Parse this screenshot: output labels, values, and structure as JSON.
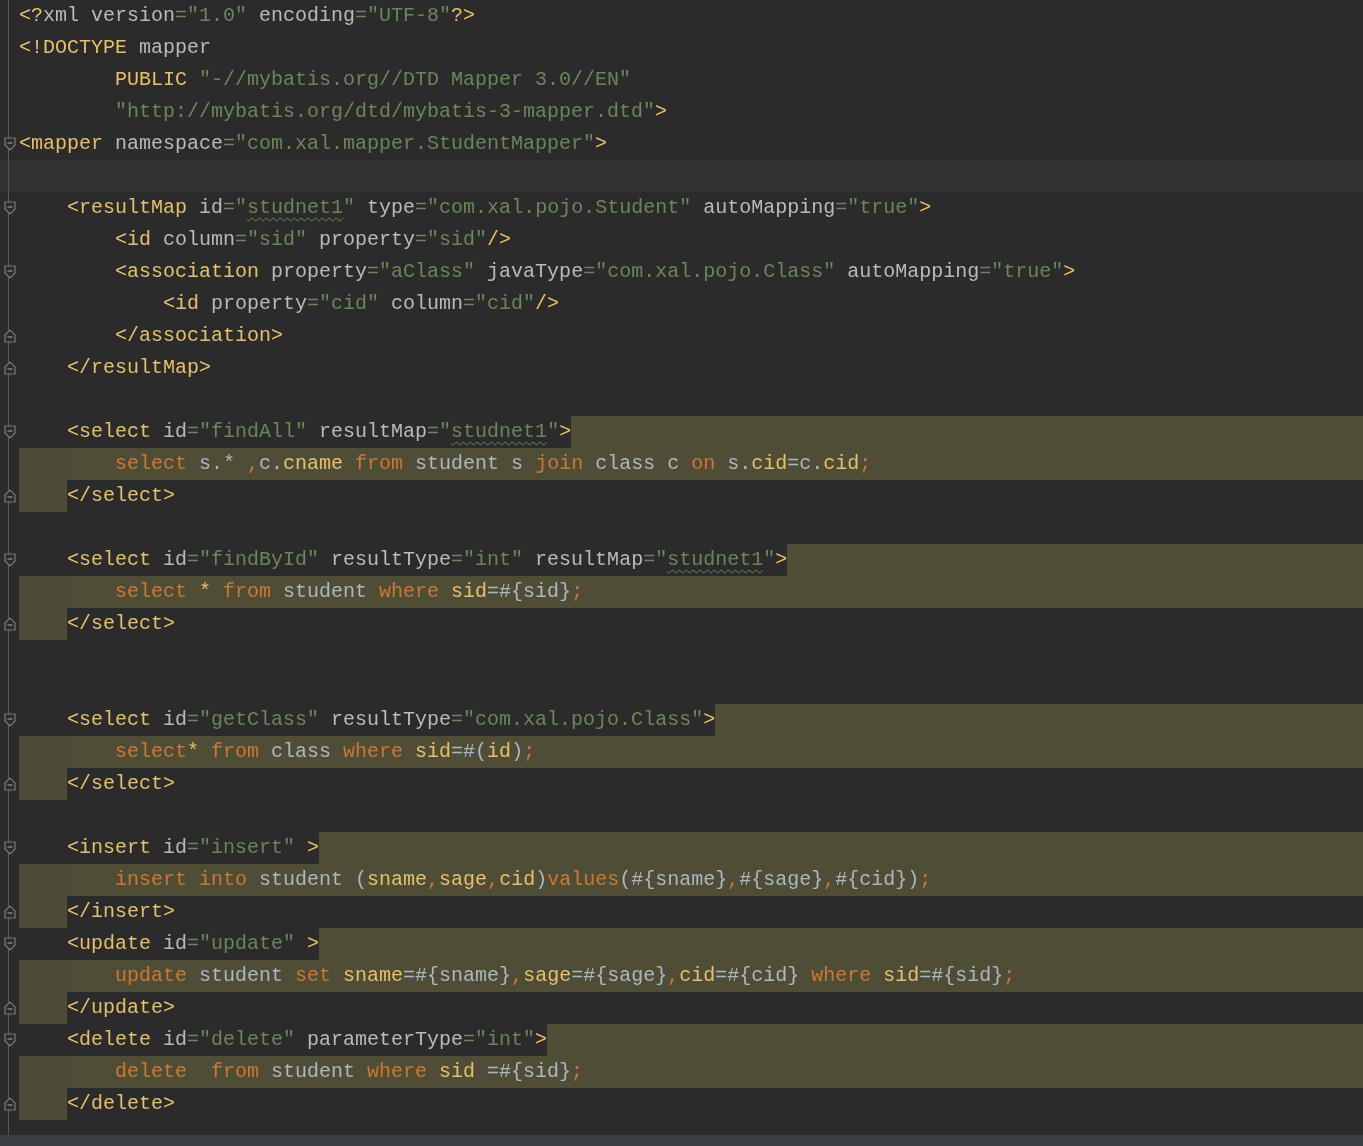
{
  "editor": {
    "lines": [
      {
        "kind": "code",
        "tokens": [
          {
            "text": "<?",
            "kind": "tag"
          },
          {
            "text": "xml version",
            "kind": "attr"
          },
          {
            "text": "=\"1.0\"",
            "kind": "str"
          },
          {
            "text": " encoding",
            "kind": "attr"
          },
          {
            "text": "=\"UTF-8\"",
            "kind": "str"
          },
          {
            "text": "?>",
            "kind": "tag"
          }
        ]
      },
      {
        "kind": "code",
        "tokens": [
          {
            "text": "<!DOCTYPE",
            "kind": "tag"
          },
          {
            "text": " mapper",
            "kind": "attr"
          }
        ]
      },
      {
        "kind": "code",
        "tokens": [
          {
            "text": "        PUBLIC",
            "kind": "tag"
          },
          {
            "text": " \"-//mybatis.org//DTD Mapper 3.0//EN\"",
            "kind": "str"
          }
        ]
      },
      {
        "kind": "code",
        "tokens": [
          {
            "text": "        \"http://mybatis.org/dtd/mybatis-3-mapper.dtd\"",
            "kind": "str"
          },
          {
            "text": ">",
            "kind": "tag"
          }
        ]
      },
      {
        "kind": "code",
        "fold_start": true,
        "tokens": [
          {
            "text": "<mapper",
            "kind": "tag"
          },
          {
            "text": " namespace",
            "kind": "attr"
          },
          {
            "text": "=\"com.xal.mapper.StudentMapper\"",
            "kind": "str"
          },
          {
            "text": ">",
            "kind": "tag"
          }
        ]
      },
      {
        "kind": "blank",
        "current": true
      },
      {
        "kind": "code",
        "fold_start": true,
        "tokens": [
          {
            "text": "    <resultMap",
            "kind": "tag"
          },
          {
            "text": " id",
            "kind": "attr"
          },
          {
            "text": "=\"",
            "kind": "str"
          },
          {
            "text": "studnet1",
            "kind": "typo"
          },
          {
            "text": "\"",
            "kind": "str"
          },
          {
            "text": " type",
            "kind": "attr"
          },
          {
            "text": "=\"com.xal.pojo.Student\"",
            "kind": "str"
          },
          {
            "text": " autoMapping",
            "kind": "attr"
          },
          {
            "text": "=\"true\"",
            "kind": "str"
          },
          {
            "text": ">",
            "kind": "tag"
          }
        ]
      },
      {
        "kind": "code",
        "tokens": [
          {
            "text": "        <id",
            "kind": "tag"
          },
          {
            "text": " column",
            "kind": "attr"
          },
          {
            "text": "=\"sid\"",
            "kind": "str"
          },
          {
            "text": " property",
            "kind": "attr"
          },
          {
            "text": "=\"sid\"",
            "kind": "str"
          },
          {
            "text": "/>",
            "kind": "tag"
          }
        ]
      },
      {
        "kind": "code",
        "fold_start": true,
        "tokens": [
          {
            "text": "        <association",
            "kind": "tag"
          },
          {
            "text": " property",
            "kind": "attr"
          },
          {
            "text": "=\"aClass\"",
            "kind": "str"
          },
          {
            "text": " javaType",
            "kind": "attr"
          },
          {
            "text": "=\"com.xal.pojo.Class\"",
            "kind": "str"
          },
          {
            "text": " autoMapping",
            "kind": "attr"
          },
          {
            "text": "=\"true\"",
            "kind": "str"
          },
          {
            "text": ">",
            "kind": "tag"
          }
        ]
      },
      {
        "kind": "code",
        "tokens": [
          {
            "text": "            <id",
            "kind": "tag"
          },
          {
            "text": " property",
            "kind": "attr"
          },
          {
            "text": "=\"cid\"",
            "kind": "str"
          },
          {
            "text": " column",
            "kind": "attr"
          },
          {
            "text": "=\"cid\"",
            "kind": "str"
          },
          {
            "text": "/>",
            "kind": "tag"
          }
        ]
      },
      {
        "kind": "code",
        "fold_end": true,
        "tokens": [
          {
            "text": "        </association>",
            "kind": "tag"
          }
        ]
      },
      {
        "kind": "code",
        "fold_end": true,
        "tokens": [
          {
            "text": "    </resultMap>",
            "kind": "tag"
          }
        ]
      },
      {
        "kind": "blank"
      },
      {
        "kind": "code",
        "fold_start": true,
        "injection_start": true,
        "tokens": [
          {
            "text": "    <select",
            "kind": "tag"
          },
          {
            "text": " id",
            "kind": "attr"
          },
          {
            "text": "=\"findAll\"",
            "kind": "str"
          },
          {
            "text": " resultMap",
            "kind": "attr"
          },
          {
            "text": "=\"",
            "kind": "str"
          },
          {
            "text": "studnet1",
            "kind": "typo"
          },
          {
            "text": "\"",
            "kind": "str"
          },
          {
            "text": ">",
            "kind": "tag"
          }
        ]
      },
      {
        "kind": "code",
        "injection_body": true,
        "tokens": [
          {
            "text": "        select",
            "kind": "kw"
          },
          {
            "text": " s.* ",
            "kind": "plain"
          },
          {
            "text": ",",
            "kind": "punct"
          },
          {
            "text": "c.",
            "kind": "plain"
          },
          {
            "text": "cname",
            "kind": "col"
          },
          {
            "text": " from",
            "kind": "kw"
          },
          {
            "text": " student s ",
            "kind": "plain"
          },
          {
            "text": "join",
            "kind": "kw"
          },
          {
            "text": " class c ",
            "kind": "plain"
          },
          {
            "text": "on",
            "kind": "kw"
          },
          {
            "text": " s.",
            "kind": "plain"
          },
          {
            "text": "cid",
            "kind": "col"
          },
          {
            "text": "=c.",
            "kind": "plain"
          },
          {
            "text": "cid",
            "kind": "col"
          },
          {
            "text": ";",
            "kind": "punct"
          }
        ]
      },
      {
        "kind": "code",
        "fold_end": true,
        "injection_end": true,
        "tokens": [
          {
            "text": "    </select>",
            "kind": "tag"
          }
        ]
      },
      {
        "kind": "blank"
      },
      {
        "kind": "code",
        "fold_start": true,
        "injection_start": true,
        "tokens": [
          {
            "text": "    <select",
            "kind": "tag"
          },
          {
            "text": " id",
            "kind": "attr"
          },
          {
            "text": "=\"findById\"",
            "kind": "str"
          },
          {
            "text": " resultType",
            "kind": "attr"
          },
          {
            "text": "=\"int\"",
            "kind": "str"
          },
          {
            "text": " resultMap",
            "kind": "attr"
          },
          {
            "text": "=\"",
            "kind": "str"
          },
          {
            "text": "studnet1",
            "kind": "typo"
          },
          {
            "text": "\"",
            "kind": "str"
          },
          {
            "text": ">",
            "kind": "tag"
          }
        ]
      },
      {
        "kind": "code",
        "injection_body": true,
        "tokens": [
          {
            "text": "        select",
            "kind": "kw"
          },
          {
            "text": " * ",
            "kind": "col"
          },
          {
            "text": "from",
            "kind": "kw"
          },
          {
            "text": " student ",
            "kind": "plain"
          },
          {
            "text": "where",
            "kind": "kw"
          },
          {
            "text": " sid",
            "kind": "col"
          },
          {
            "text": "=#{sid}",
            "kind": "plain"
          },
          {
            "text": ";",
            "kind": "punct"
          }
        ]
      },
      {
        "kind": "code",
        "fold_end": true,
        "injection_end": true,
        "tokens": [
          {
            "text": "    </select>",
            "kind": "tag"
          }
        ]
      },
      {
        "kind": "blank"
      },
      {
        "kind": "blank"
      },
      {
        "kind": "code",
        "fold_start": true,
        "injection_start": true,
        "tokens": [
          {
            "text": "    <select",
            "kind": "tag"
          },
          {
            "text": " id",
            "kind": "attr"
          },
          {
            "text": "=\"getClass\"",
            "kind": "str"
          },
          {
            "text": " resultType",
            "kind": "attr"
          },
          {
            "text": "=\"com.xal.pojo.Class\"",
            "kind": "str"
          },
          {
            "text": ">",
            "kind": "tag"
          }
        ]
      },
      {
        "kind": "code",
        "injection_body": true,
        "tokens": [
          {
            "text": "        select",
            "kind": "kw"
          },
          {
            "text": "* ",
            "kind": "col"
          },
          {
            "text": "from",
            "kind": "kw"
          },
          {
            "text": " class ",
            "kind": "plain"
          },
          {
            "text": "where",
            "kind": "kw"
          },
          {
            "text": " sid",
            "kind": "col"
          },
          {
            "text": "=#(",
            "kind": "plain"
          },
          {
            "text": "id",
            "kind": "col"
          },
          {
            "text": ")",
            "kind": "plain"
          },
          {
            "text": ";",
            "kind": "punct"
          }
        ]
      },
      {
        "kind": "code",
        "fold_end": true,
        "injection_end": true,
        "tokens": [
          {
            "text": "    </select>",
            "kind": "tag"
          }
        ]
      },
      {
        "kind": "blank"
      },
      {
        "kind": "code",
        "fold_start": true,
        "injection_start": true,
        "tokens": [
          {
            "text": "    <insert",
            "kind": "tag"
          },
          {
            "text": " id",
            "kind": "attr"
          },
          {
            "text": "=\"insert\"",
            "kind": "str"
          },
          {
            "text": " >",
            "kind": "tag"
          }
        ]
      },
      {
        "kind": "code",
        "injection_body": true,
        "tokens": [
          {
            "text": "        insert into",
            "kind": "kw"
          },
          {
            "text": " student (",
            "kind": "plain"
          },
          {
            "text": "sname",
            "kind": "col"
          },
          {
            "text": ",",
            "kind": "punct"
          },
          {
            "text": "sage",
            "kind": "col"
          },
          {
            "text": ",",
            "kind": "punct"
          },
          {
            "text": "cid",
            "kind": "col"
          },
          {
            "text": ")",
            "kind": "plain"
          },
          {
            "text": "values",
            "kind": "kw"
          },
          {
            "text": "(#{sname}",
            "kind": "plain"
          },
          {
            "text": ",",
            "kind": "punct"
          },
          {
            "text": "#{sage}",
            "kind": "plain"
          },
          {
            "text": ",",
            "kind": "punct"
          },
          {
            "text": "#{cid})",
            "kind": "plain"
          },
          {
            "text": ";",
            "kind": "punct"
          }
        ]
      },
      {
        "kind": "code",
        "fold_end": true,
        "injection_end": true,
        "tokens": [
          {
            "text": "    </insert>",
            "kind": "tag"
          }
        ]
      },
      {
        "kind": "code",
        "fold_start": true,
        "injection_start": true,
        "tokens": [
          {
            "text": "    <update",
            "kind": "tag"
          },
          {
            "text": " id",
            "kind": "attr"
          },
          {
            "text": "=\"update\"",
            "kind": "str"
          },
          {
            "text": " >",
            "kind": "tag"
          }
        ]
      },
      {
        "kind": "code",
        "injection_body": true,
        "tokens": [
          {
            "text": "        update",
            "kind": "kw"
          },
          {
            "text": " student ",
            "kind": "plain"
          },
          {
            "text": "set",
            "kind": "kw"
          },
          {
            "text": " sname",
            "kind": "col"
          },
          {
            "text": "=#{sname}",
            "kind": "plain"
          },
          {
            "text": ",",
            "kind": "punct"
          },
          {
            "text": "sage",
            "kind": "col"
          },
          {
            "text": "=#{sage}",
            "kind": "plain"
          },
          {
            "text": ",",
            "kind": "punct"
          },
          {
            "text": "cid",
            "kind": "col"
          },
          {
            "text": "=#{cid} ",
            "kind": "plain"
          },
          {
            "text": "where",
            "kind": "kw"
          },
          {
            "text": " sid",
            "kind": "col"
          },
          {
            "text": "=#{sid}",
            "kind": "plain"
          },
          {
            "text": ";",
            "kind": "punct"
          }
        ]
      },
      {
        "kind": "code",
        "fold_end": true,
        "injection_end": true,
        "tokens": [
          {
            "text": "    </update>",
            "kind": "tag"
          }
        ]
      },
      {
        "kind": "code",
        "fold_start": true,
        "injection_start": true,
        "tokens": [
          {
            "text": "    <delete",
            "kind": "tag"
          },
          {
            "text": " id",
            "kind": "attr"
          },
          {
            "text": "=\"delete\"",
            "kind": "str"
          },
          {
            "text": " parameterType",
            "kind": "attr"
          },
          {
            "text": "=\"int\"",
            "kind": "str"
          },
          {
            "text": ">",
            "kind": "tag"
          }
        ]
      },
      {
        "kind": "code",
        "injection_body": true,
        "tokens": [
          {
            "text": "        delete",
            "kind": "kw"
          },
          {
            "text": "  from",
            "kind": "kw"
          },
          {
            "text": " student ",
            "kind": "plain"
          },
          {
            "text": "where",
            "kind": "kw"
          },
          {
            "text": " sid ",
            "kind": "col"
          },
          {
            "text": "=#{sid}",
            "kind": "plain"
          },
          {
            "text": ";",
            "kind": "punct"
          }
        ]
      },
      {
        "kind": "code",
        "fold_end": true,
        "injection_end": true,
        "tokens": [
          {
            "text": "    </delete>",
            "kind": "tag"
          }
        ]
      }
    ]
  }
}
